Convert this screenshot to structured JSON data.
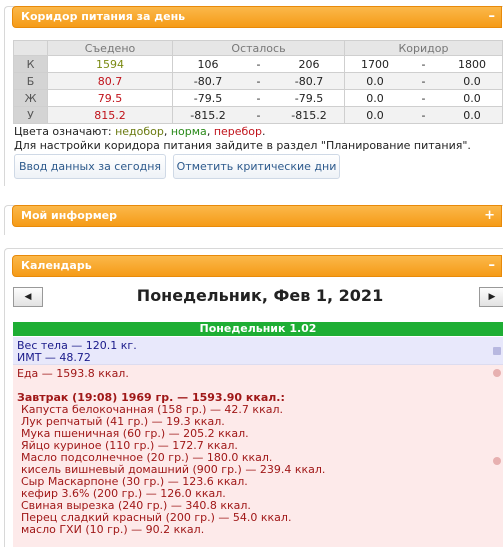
{
  "corridor": {
    "title": "Коридор питания за день",
    "toggle": "–",
    "headers": {
      "eaten": "Съедено",
      "left": "Осталось",
      "corridor": "Коридор"
    },
    "rows": [
      {
        "label": "К",
        "eaten": "1594",
        "left_a": "106",
        "left_b": "206",
        "cor_a": "1700",
        "cor_b": "1800"
      },
      {
        "label": "Б",
        "eaten": "80.7",
        "left_a": "-80.7",
        "left_b": "-80.7",
        "cor_a": "0.0",
        "cor_b": "0.0"
      },
      {
        "label": "Ж",
        "eaten": "79.5",
        "left_a": "-79.5",
        "left_b": "-79.5",
        "cor_a": "0.0",
        "cor_b": "0.0"
      },
      {
        "label": "У",
        "eaten": "815.2",
        "left_a": "-815.2",
        "left_b": "-815.2",
        "cor_a": "0.0",
        "cor_b": "0.0"
      }
    ],
    "dash": "-",
    "legend_prefix": "Цвета означают: ",
    "legend_under": "недобор",
    "legend_sep": ", ",
    "legend_norm": "норма",
    "legend_over": "перебор",
    "legend_end": ".",
    "settings_note": "Для настройки коридора питания зайдите в раздел \"Планирование питания\".",
    "btn_today": "Ввод данных за сегодня",
    "btn_critical": "Отметить критические дни"
  },
  "informer": {
    "title": "Мой информер",
    "toggle": "+"
  },
  "calendar": {
    "title": "Календарь",
    "toggle": "–",
    "prev": "◀",
    "next": "▶",
    "date": "Понедельник, Фев 1, 2021",
    "day_header": "Понедельник 1.02",
    "weight_line": "Вес тела — 120.1 кг.",
    "bmi_line": "ИМТ — 48.72",
    "food_total": "Еда — 1593.8 ккал.",
    "meal": "Завтрак (19:08) 1969 гр. — 1593.90 ккал.:",
    "items": [
      "Капуста белокочанная (158 гр.) — 42.7 ккал.",
      "Лук репчатый (41 гр.) — 19.3 ккал.",
      "Мука пшеничная (60 гр.) — 205.2 ккал.",
      "Яйцо куриное (110 гр.) — 172.7 ккал.",
      "Масло подсолнечное (20 гр.) — 180.0 ккал.",
      "кисель вишневый домашний (900 гр.) — 239.4 ккал.",
      "Сыр Маскарпоне (30 гр.) — 123.6 ккал.",
      "кефир 3.6% (200 гр.) — 126.0 ккал.",
      "Свиная вырезка (240 гр.) — 340.8 ккал.",
      "Перец сладкий красный (200 гр.) — 54.0 ккал.",
      "масло ГХИ (10 гр.) — 90.2 ккал."
    ]
  },
  "colors": {
    "accent_orange": "#f59b17",
    "day_green": "#1eae34",
    "under": "#7a8a12",
    "over": "#c0121a"
  }
}
